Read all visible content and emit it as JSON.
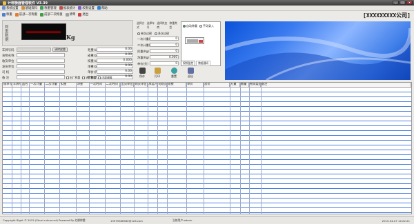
{
  "window": {
    "title": "计称衡器管理软件 V3.39",
    "btn_min": "_",
    "btn_max": "□",
    "btn_close": "×"
  },
  "menu": [
    "系统设置",
    "基础资料",
    "称重管理",
    "报表统计",
    "权限设置",
    "帮助"
  ],
  "toolbar": [
    "称重",
    "前部一次称重",
    "前部二次称重",
    "清零",
    "退出"
  ],
  "company": "[XXXXXXXXX公司]",
  "weight": {
    "label": "称重数据",
    "unit": "Kg"
  },
  "form": {
    "rows": [
      {
        "label": "车牌号码",
        "right_label": "毛重(公斤)",
        "right_value": "0.00"
      },
      {
        "label": "货物名称",
        "right_label": "皮重(公斤)",
        "right_value": "0.00"
      },
      {
        "label": "收货单位",
        "right_label": "扣重(公斤)",
        "right_value": "0.000"
      },
      {
        "label": "发货单位",
        "right_label": "净重(公斤)",
        "right_value": "0.00"
      },
      {
        "label": "司 机",
        "right_label": "单价(元)",
        "right_value": "0.00"
      },
      {
        "label": "备 注",
        "right_label": "金额(元)",
        "right_value": "0.00"
      }
    ],
    "clear_btn": "清除皮重",
    "checks": [
      "出厂称重",
      "进厂称重",
      "内部调拨"
    ]
  },
  "mid": {
    "header": [
      "选择方式",
      "选择车号",
      "选择供应商",
      "称重类型"
    ],
    "radio1": "单次过磅",
    "radio2": "多次过磅",
    "rows": [
      {
        "label": "一次计重(Kg)",
        "value": "0"
      },
      {
        "label": "二次计重(Kg)",
        "value": "0"
      },
      {
        "label": "扣重(Kg)",
        "value": "0"
      },
      {
        "label": "净重(Kg)",
        "value": "0.000"
      },
      {
        "label": "单价(元)",
        "value": "0"
      }
    ]
  },
  "camera": {
    "opt1": "自动称重",
    "opt2": "手动录入",
    "tabs": [
      "视频监控",
      "数据通讯"
    ]
  },
  "actions": [
    "保存",
    "打印",
    "重置",
    "退出"
  ],
  "grid": {
    "columns": [
      "磅单号",
      "车牌号",
      "品名",
      "一次计量",
      "二次计量",
      "扣重",
      "净重",
      "一次时间",
      "二次时间",
      "出货单位",
      "购货单位",
      "承运人",
      "司磅员",
      "磅费",
      "单价",
      "总价",
      "方量",
      "数量",
      "物资类别",
      "备注"
    ]
  },
  "status": {
    "left": "Copyright Right © 2015 (Shuzi.ruhua.net) Powered By 红柳称重",
    "mid": "13979386580@126.com",
    "user": "当前用户:admin",
    "time": "2015-04-07 14:22:21"
  }
}
